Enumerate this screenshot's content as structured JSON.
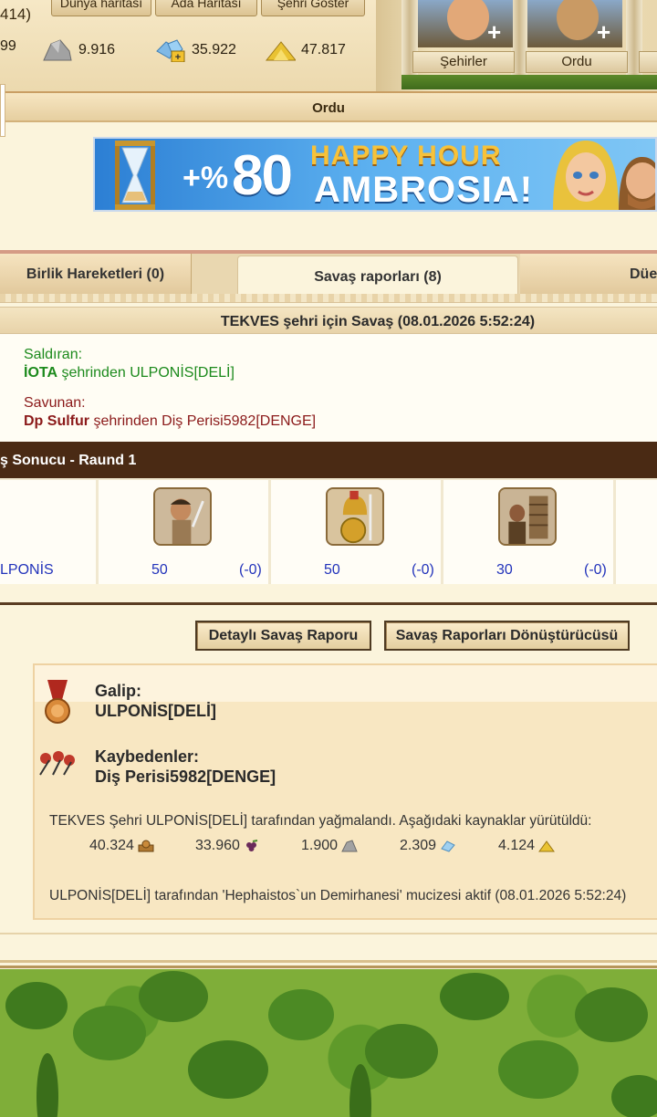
{
  "hud": {
    "coin_partial": "414)",
    "buttons": [
      "Dünya haritası",
      "Ada Haritası",
      "Şehri Göster"
    ],
    "resources": {
      "res0": "99",
      "stone": "9.916",
      "favor": "35.922",
      "gold": "47.817"
    },
    "advisors": [
      "Şehirler",
      "Ordu"
    ]
  },
  "window": {
    "title": "Ordu"
  },
  "banner": {
    "plus_pct": "+%",
    "number": "80",
    "line1": "HAPPY HOUR",
    "line2": "AMBROSIA!"
  },
  "tabs": [
    {
      "label": "Birlik Hareketleri (0)",
      "active": false
    },
    {
      "label": "Savaş raporları (8)",
      "active": true
    },
    {
      "label": "Düe",
      "active": false
    }
  ],
  "report": {
    "title": "TEKVES şehri için Savaş (08.01.2026 5:52:24)",
    "attacker_label": "Saldıran:",
    "attacker_city": "İOTA",
    "attacker_rest": " şehrinden ULPONİS[DELİ]",
    "defender_label": "Savunan:",
    "defender_city": "Dp Sulfur",
    "defender_rest": " şehrinden Diş Perisi5982[DENGE]",
    "round_title": "ş Sonucu - Raund 1",
    "player_row_name": "LPONİS",
    "units": [
      {
        "count": "50",
        "loss": "(-0)",
        "icon": "slinger-unit-icon"
      },
      {
        "count": "50",
        "loss": "(-0)",
        "icon": "hoplite-unit-icon"
      },
      {
        "count": "30",
        "loss": "(-0)",
        "icon": "catapult-unit-icon"
      }
    ]
  },
  "buttons": {
    "detailed": "Detaylı Savaş Raporu",
    "converter": "Savaş Raporları Dönüştürücüsü"
  },
  "result": {
    "winner_label": "Galip:",
    "winner_name": "ULPONİS[DELİ]",
    "loser_label": "Kaybedenler:",
    "loser_name": "Diş Perisi5982[DENGE]",
    "plunder_text": "TEKVES Şehri ULPONİS[DELİ] tarafından yağmalandı. Aşağıdaki kaynaklar yürütüldü:",
    "loot": [
      {
        "value": "40.324",
        "icon": "wood-icon"
      },
      {
        "value": "33.960",
        "icon": "wine-icon"
      },
      {
        "value": "1.900",
        "icon": "stone-icon"
      },
      {
        "value": "2.309",
        "icon": "silver-icon"
      },
      {
        "value": "4.124",
        "icon": "gold-icon"
      }
    ],
    "wonder_text": "ULPONİS[DELİ] tarafından 'Hephaistos`un Demirhanesi' mucizesi aktif (08.01.2026 5:52:24)"
  },
  "colors": {
    "attacker": "#1c8a1c",
    "defender": "#8b1a1a",
    "round_header": "#4a2a14",
    "unit_text": "#2233bb"
  }
}
